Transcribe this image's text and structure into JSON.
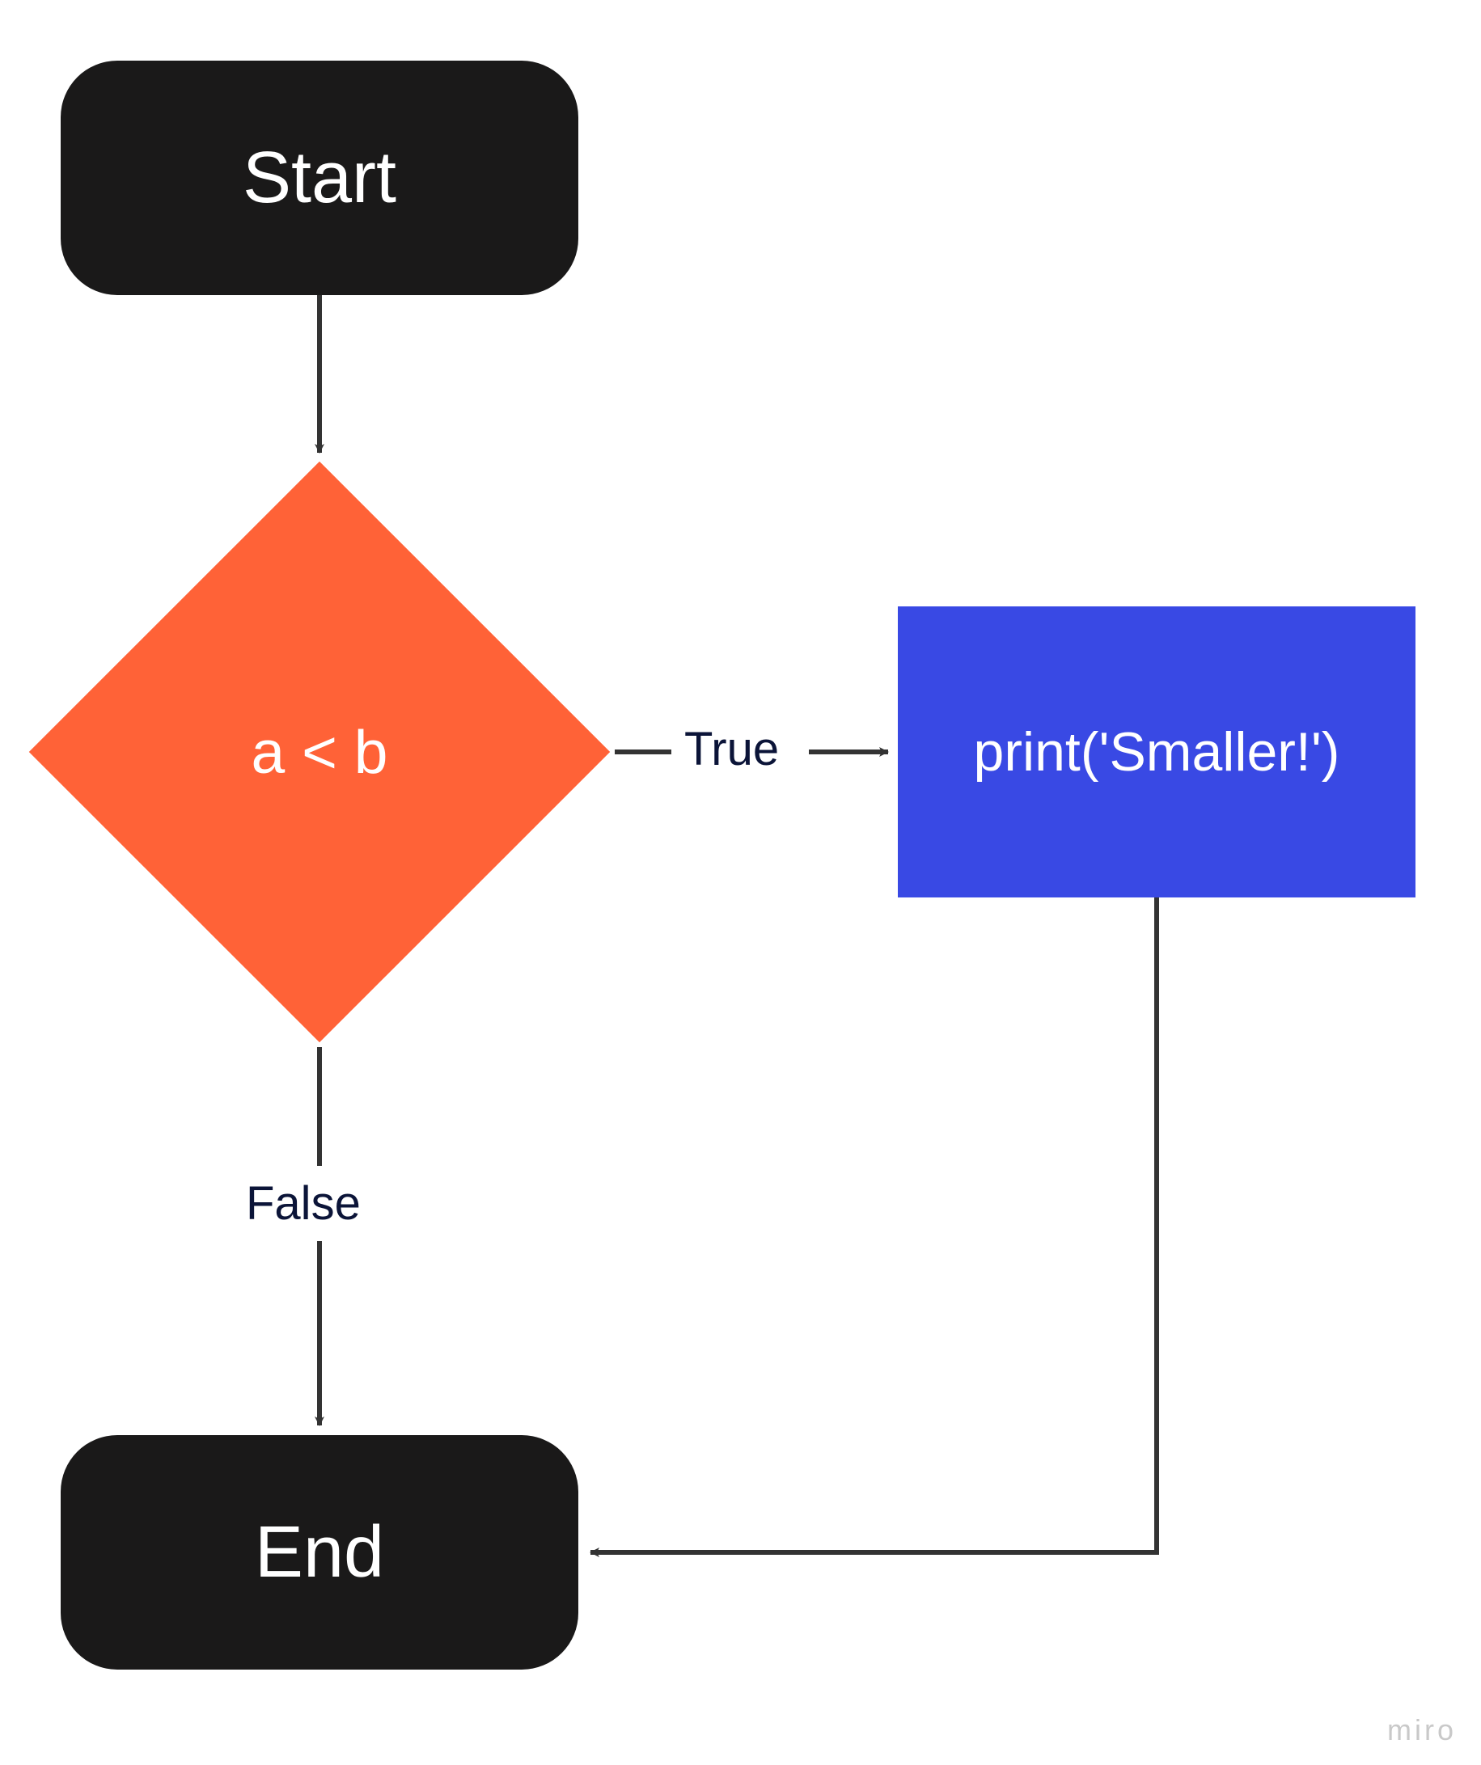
{
  "diagram": {
    "nodes": {
      "start": {
        "label": "Start",
        "type": "terminator"
      },
      "decision": {
        "label": "a < b",
        "type": "decision"
      },
      "process": {
        "label": "print('Smaller!')",
        "type": "process"
      },
      "end": {
        "label": "End",
        "type": "terminator"
      }
    },
    "edges": {
      "start_to_decision": {
        "from": "start",
        "to": "decision",
        "label": ""
      },
      "decision_true": {
        "from": "decision",
        "to": "process",
        "label": "True"
      },
      "decision_false": {
        "from": "decision",
        "to": "end",
        "label": "False"
      },
      "process_to_end": {
        "from": "process",
        "to": "end",
        "label": ""
      }
    }
  },
  "colors": {
    "terminator_bg": "#1a1919",
    "decision_bg": "#ff6237",
    "process_bg": "#3949e4",
    "arrow": "#333333",
    "edge_label": "#0b1438"
  },
  "watermark": "miro"
}
